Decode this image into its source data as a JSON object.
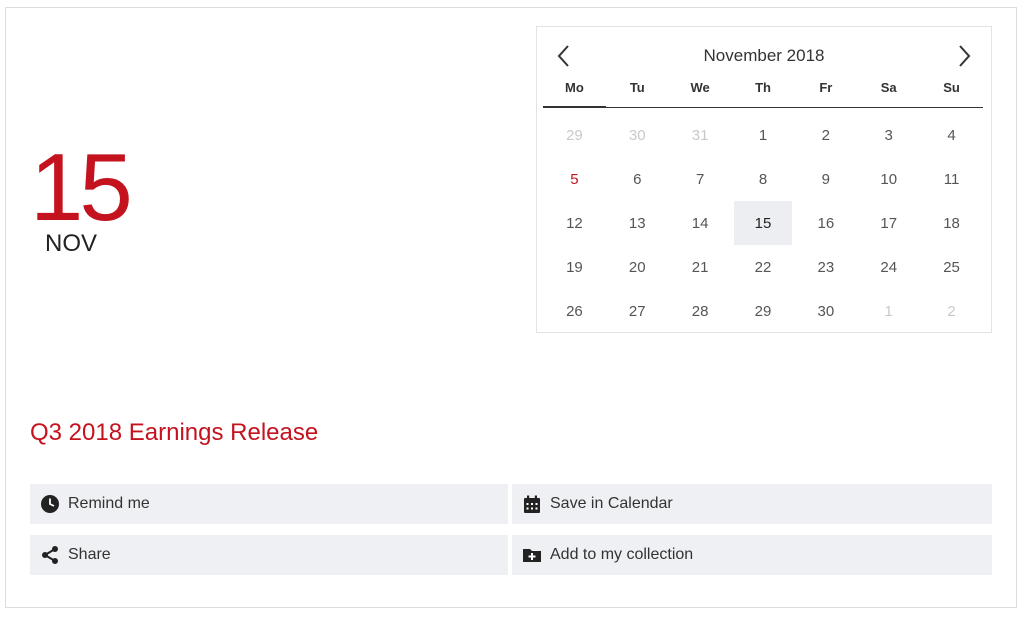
{
  "colors": {
    "accent": "#c4131f",
    "action_bg": "#eef0f3",
    "selected_bg": "#eceef1"
  },
  "date_display": {
    "day": "15",
    "month": "NOV"
  },
  "calendar": {
    "title": "November 2018",
    "weekdays": [
      "Mo",
      "Tu",
      "We",
      "Th",
      "Fr",
      "Sa",
      "Su"
    ],
    "weeks": [
      [
        {
          "d": "29",
          "t": "other"
        },
        {
          "d": "30",
          "t": "other"
        },
        {
          "d": "31",
          "t": "other"
        },
        {
          "d": "1",
          "t": ""
        },
        {
          "d": "2",
          "t": ""
        },
        {
          "d": "3",
          "t": ""
        },
        {
          "d": "4",
          "t": ""
        }
      ],
      [
        {
          "d": "5",
          "t": "holiday"
        },
        {
          "d": "6",
          "t": ""
        },
        {
          "d": "7",
          "t": ""
        },
        {
          "d": "8",
          "t": ""
        },
        {
          "d": "9",
          "t": ""
        },
        {
          "d": "10",
          "t": ""
        },
        {
          "d": "11",
          "t": ""
        }
      ],
      [
        {
          "d": "12",
          "t": ""
        },
        {
          "d": "13",
          "t": ""
        },
        {
          "d": "14",
          "t": ""
        },
        {
          "d": "15",
          "t": "selected"
        },
        {
          "d": "16",
          "t": ""
        },
        {
          "d": "17",
          "t": ""
        },
        {
          "d": "18",
          "t": ""
        }
      ],
      [
        {
          "d": "19",
          "t": ""
        },
        {
          "d": "20",
          "t": ""
        },
        {
          "d": "21",
          "t": ""
        },
        {
          "d": "22",
          "t": ""
        },
        {
          "d": "23",
          "t": ""
        },
        {
          "d": "24",
          "t": ""
        },
        {
          "d": "25",
          "t": ""
        }
      ],
      [
        {
          "d": "26",
          "t": ""
        },
        {
          "d": "27",
          "t": ""
        },
        {
          "d": "28",
          "t": ""
        },
        {
          "d": "29",
          "t": ""
        },
        {
          "d": "30",
          "t": ""
        },
        {
          "d": "1",
          "t": "other"
        },
        {
          "d": "2",
          "t": "other"
        }
      ]
    ],
    "prev_icon": "chevron-left-icon",
    "next_icon": "chevron-right-icon"
  },
  "event": {
    "title": "Q3 2018 Earnings Release"
  },
  "actions": [
    {
      "label": "Remind me",
      "icon": "clock-icon"
    },
    {
      "label": "Save in Calendar",
      "icon": "calendar-icon"
    },
    {
      "label": "Share",
      "icon": "share-icon"
    },
    {
      "label": "Add to my collection",
      "icon": "folder-plus-icon"
    }
  ]
}
